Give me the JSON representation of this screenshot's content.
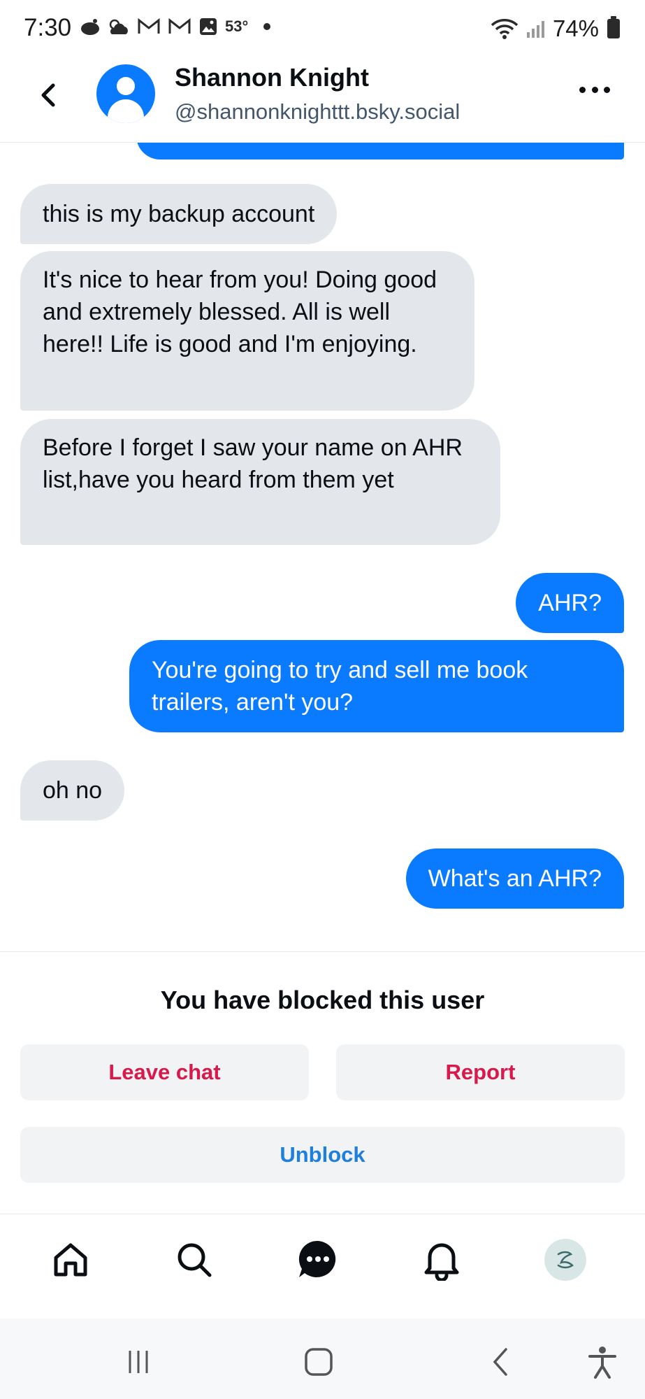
{
  "status_bar": {
    "time": "7:30",
    "temperature": "53°",
    "battery": "74%"
  },
  "header": {
    "name": "Shannon Knight",
    "handle": "@shannonknighttt.bsky.social"
  },
  "messages": [
    {
      "sender": "them",
      "text": "this is my backup account"
    },
    {
      "sender": "them",
      "text": "It's nice to hear from you! Doing good and extremely blessed. All is well here!! Life is good and I'm enjoying."
    },
    {
      "sender": "them",
      "text": "Before I forget I saw your name on AHR list,have you heard from them yet"
    },
    {
      "sender": "me",
      "text": "AHR?"
    },
    {
      "sender": "me",
      "text": "You're going to try and sell me book trailers, aren't you?"
    },
    {
      "sender": "them",
      "text": "oh no"
    },
    {
      "sender": "me",
      "text": "What's an AHR?"
    }
  ],
  "blocked": {
    "title": "You have blocked this user",
    "leave_label": "Leave chat",
    "report_label": "Report",
    "unblock_label": "Unblock"
  },
  "nav_bar": {
    "items": [
      "home-icon",
      "search-icon",
      "chat-icon",
      "bell-icon",
      "profile-avatar"
    ]
  },
  "colors": {
    "accent": "#0a7aff",
    "received_bubble": "#e3e7ec",
    "danger": "#d9184b",
    "link": "#1f7fdc"
  }
}
